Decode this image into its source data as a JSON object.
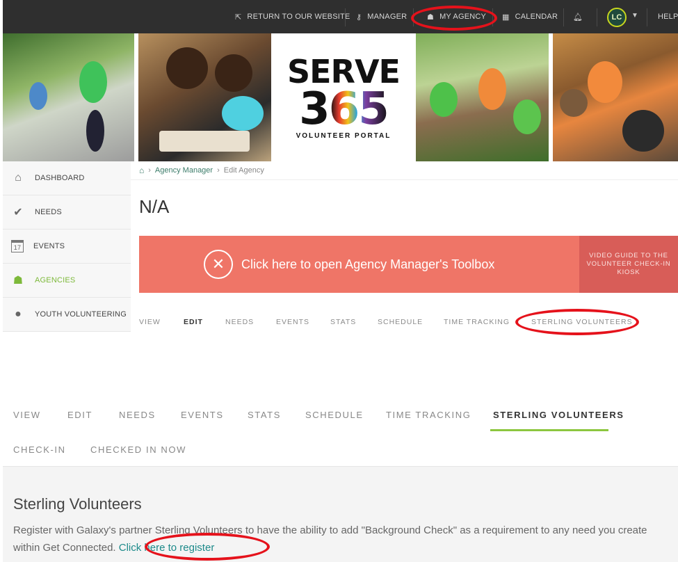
{
  "topnav": {
    "return": "RETURN TO OUR WEBSITE",
    "manager": "MANAGER",
    "my_agency": "MY AGENCY",
    "calendar": "CALENDAR",
    "avatar": "LC",
    "help": "HELP"
  },
  "logo": {
    "serve": "SERVE",
    "number": "365",
    "sub": "VOLUNTEER PORTAL"
  },
  "sidebar": {
    "items": [
      {
        "label": "DASHBOARD"
      },
      {
        "label": "NEEDS"
      },
      {
        "label": "EVENTS",
        "icon_text": "17"
      },
      {
        "label": "AGENCIES"
      },
      {
        "label": "YOUTH VOLUNTEERING"
      }
    ]
  },
  "breadcrumb": {
    "level1": "Agency Manager",
    "level2": "Edit Agency"
  },
  "page": {
    "title": "N/A"
  },
  "toolbox": {
    "label": "Click here to open Agency Manager's Toolbox",
    "video_guide": "VIDEO GUIDE TO THE VOLUNTEER CHECK-IN KIOSK"
  },
  "tabs_small": [
    "VIEW",
    "EDIT",
    "NEEDS",
    "EVENTS",
    "STATS",
    "SCHEDULE",
    "TIME TRACKING",
    "STERLING VOLUNTEERS"
  ],
  "tabs_large": [
    "VIEW",
    "EDIT",
    "NEEDS",
    "EVENTS",
    "STATS",
    "SCHEDULE",
    "TIME TRACKING",
    "STERLING VOLUNTEERS",
    "CHECK-IN",
    "CHECKED IN NOW"
  ],
  "sterling": {
    "title": "Sterling Volunteers",
    "text_before": "Register with Galaxy's partner Sterling Volunteers to have the ability to add \"Background Check\" as a requirement to any need you create within Get Connected.",
    "link": "Click here to register"
  },
  "colors": {
    "topbar": "#2f2f2f",
    "accent_green": "#8cc63f",
    "toolbox": "#ef7567",
    "annotation_red": "#e5121b"
  }
}
